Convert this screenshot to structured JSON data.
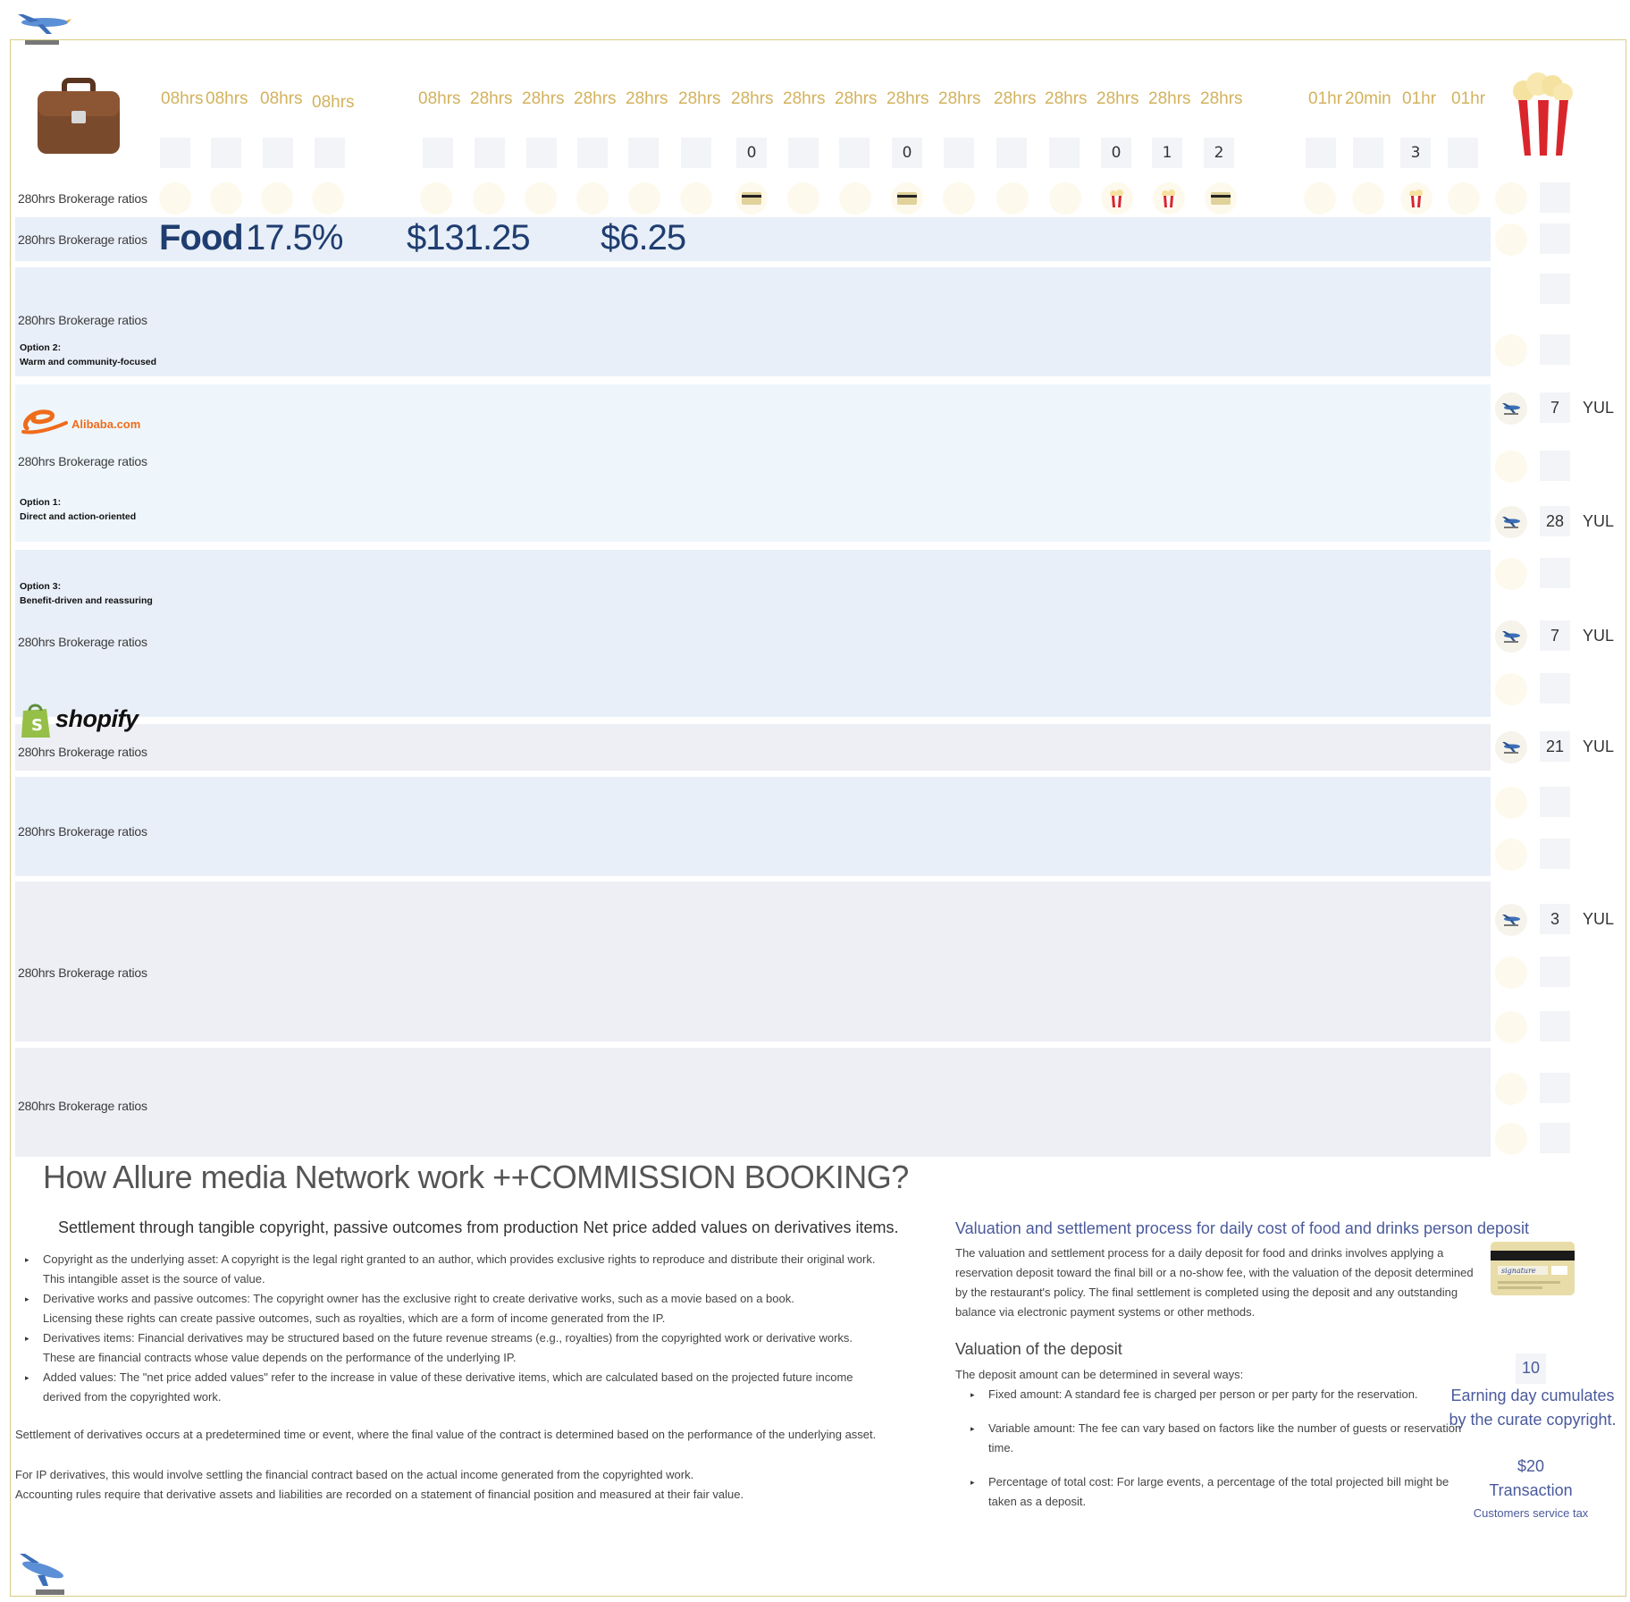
{
  "header": {
    "time_labels": [
      "08hrs",
      "08hrs",
      "08hrs",
      "08hrs",
      "08hrs",
      "28hrs",
      "28hrs",
      "28hrs",
      "28hrs",
      "28hrs",
      "28hrs",
      "28hrs",
      "28hrs",
      "28hrs",
      "28hrs",
      "28hrs",
      "28hrs",
      "28hrs",
      "28hrs",
      "28hrs",
      "01hr",
      "20min",
      "01hr",
      "01hr"
    ],
    "counter_values": [
      "",
      "",
      "",
      "",
      "",
      "",
      "",
      "",
      "",
      "",
      "0",
      "",
      "",
      "0",
      "",
      "",
      "",
      "0",
      "1",
      "2",
      "",
      "",
      "3"
    ],
    "briefcase_icon": "briefcase-icon",
    "popcorn_icon": "popcorn-icon"
  },
  "rows": {
    "label": "280hrs Brokerage ratios",
    "food_label": "Food",
    "food_percent": "17.5%",
    "food_price": "$131.25",
    "food_fee": "$6.25",
    "option2_title": "Option 2:",
    "option2_desc": "Warm and community-focused",
    "option1_title": "Option 1:",
    "option1_desc": "Direct and action-oriented",
    "option3_title": "Option 3:",
    "option3_desc": "Benefit-driven and reassuring",
    "alibaba_text": "Alibaba.com",
    "shopify_text": "shopify"
  },
  "right_column": {
    "counts": [
      "7",
      "28",
      "7",
      "21",
      "3"
    ],
    "airport": "YUL"
  },
  "article": {
    "title": "How Allure media Network work ++COMMISSION BOOKING?",
    "subtitle": "Settlement through tangible copyright, passive outcomes from production Net price added values on derivatives items.",
    "bullets": [
      [
        "Copyright as the underlying asset: A copyright is the legal right granted to an author, which provides exclusive rights to reproduce and distribute their original work.",
        "This intangible asset is the source of value."
      ],
      [
        "Derivative works and passive outcomes: The copyright owner has the exclusive right to create derivative works, such as a movie based on a book.",
        "Licensing these rights can create passive outcomes, such as royalties, which are a form of income generated from the IP."
      ],
      [
        "Derivatives items: Financial derivatives may be structured based on the future revenue streams (e.g., royalties) from the copyrighted work or derivative works.",
        "These are financial contracts whose value depends on the performance of the underlying IP."
      ],
      [
        "Added values: The \"net price added values\" refer to the increase in value of these derivative items, which are calculated based on the projected future income",
        "derived from the copyrighted work."
      ]
    ],
    "para1": "Settlement of derivatives occurs at a predetermined time or event, where the final value of the contract is determined based on the performance of the underlying asset.",
    "para2": "For IP derivatives, this would involve settling the financial contract based on the actual income generated from the copyrighted work.",
    "para3": "Accounting rules require that derivative assets and liabilities are recorded on a statement of financial position and measured at their fair value."
  },
  "valuation": {
    "title": "Valuation and settlement process  for daily cost of food and drinks person deposit",
    "body": "The valuation and settlement process for a daily deposit for food and drinks involves applying a reservation deposit toward the final bill or a no-show fee, with the valuation of the deposit determined by the restaurant's policy. The final settlement is completed using the deposit and any outstanding balance via electronic payment systems or other methods.",
    "deposit_heading": "Valuation of the deposit",
    "deposit_intro": "The deposit amount can be determined in several ways:",
    "deposit_items": [
      "Fixed amount: A standard fee is charged per person or per party for the reservation.",
      "Variable amount: The fee can vary based on factors like the number of guests or reservation time.",
      "Percentage of total cost: For large events, a percentage of the total projected bill might be taken as a deposit."
    ]
  },
  "sidebar_stats": {
    "earning_value": "10",
    "earning_label": "Earning day cumulates by the curate copyright.",
    "transaction_value": "$20",
    "transaction_label": "Transaction",
    "transaction_note": "Customers service tax"
  },
  "colors": {
    "gold": "#d3b25d",
    "navy": "#1f3d70",
    "band_blue": "#e8eff8",
    "band_light": "#eef6fc",
    "band_gray": "#edeff4",
    "purple_blue": "#4a5a9c"
  }
}
